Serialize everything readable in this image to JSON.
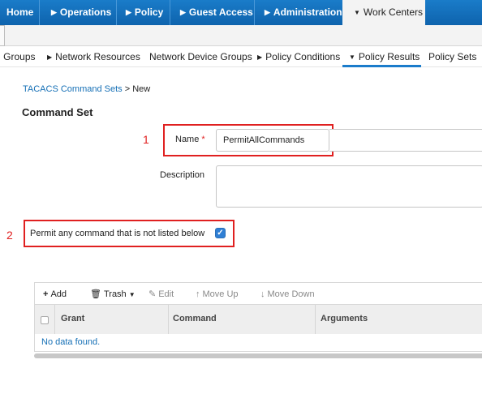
{
  "top_nav": {
    "items": [
      {
        "label": "Home"
      },
      {
        "label": "Operations"
      },
      {
        "label": "Policy"
      },
      {
        "label": "Guest Access"
      },
      {
        "label": "Administration"
      },
      {
        "label": "Work Centers"
      }
    ]
  },
  "sub_nav": {
    "items": [
      {
        "label": "Groups"
      },
      {
        "label": "Network Resources"
      },
      {
        "label": "Network Device Groups"
      },
      {
        "label": "Policy Conditions"
      },
      {
        "label": "Policy Results"
      },
      {
        "label": "Policy Sets"
      }
    ],
    "active": "Policy Results"
  },
  "breadcrumb": {
    "link": "TACACS Command Sets",
    "separator": ">",
    "current": "New"
  },
  "page_title": "Command Set",
  "annotations": {
    "one": "1",
    "two": "2"
  },
  "form": {
    "name_label": "Name",
    "required_mark": "*",
    "name_value": "PermitAllCommands",
    "description_label": "Description",
    "description_value": "",
    "permit_label": "Permit any command that is not listed below",
    "permit_checked": true
  },
  "toolbar": {
    "add": "Add",
    "trash": "Trash",
    "edit": "Edit",
    "move_up": "Move Up",
    "move_down": "Move Down"
  },
  "table": {
    "columns": [
      "Grant",
      "Command",
      "Arguments"
    ],
    "empty_text": "No data found."
  },
  "colors": {
    "nav_blue": "#1a7cc9",
    "accent": "#1b7ccb",
    "callout_red": "#e02020"
  }
}
